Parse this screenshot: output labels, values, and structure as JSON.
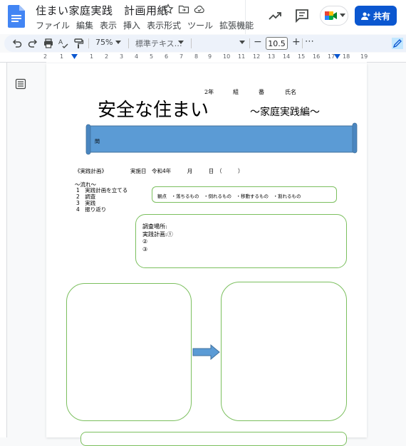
{
  "header": {
    "doc_title": "住まい家庭実践　計画用紙",
    "menu": [
      "ファイル",
      "編集",
      "表示",
      "挿入",
      "表示形式",
      "ツール",
      "拡張機能"
    ],
    "share_label": "共有"
  },
  "toolbar": {
    "zoom": "75%",
    "style": "標準テキス…",
    "font_size": "10.5",
    "minus": "−",
    "plus": "+",
    "more": "⋯"
  },
  "ruler": {
    "numbers": [
      "2",
      "1",
      "1",
      "2",
      "3",
      "4",
      "5",
      "6",
      "7",
      "8",
      "9",
      "10",
      "11",
      "12",
      "13",
      "14",
      "15",
      "16",
      "17",
      "18",
      "19"
    ]
  },
  "document": {
    "name_line": {
      "grade": "2年",
      "class": "組",
      "number": "番",
      "name": "氏名"
    },
    "title_main": "安全な住まい",
    "title_sub": "〜家庭実践編〜",
    "question_label": "問",
    "plan_heading": "《実践計画》",
    "date_label": "実施日　令和4年　　　月　　　日　（　　　）",
    "flow_title": "〜流れ〜",
    "flow_steps": [
      "1　実践計画を立てる",
      "2　調査",
      "3　実践",
      "4　振り返り"
    ],
    "viewpoint": "観点　・落ちるもの　・倒れるもの　・移動するもの　・割れるもの",
    "survey_lines": [
      "調査場所:",
      "実践計画:①",
      "②",
      "③"
    ]
  },
  "colors": {
    "share": "#0b57d0",
    "banner": "#5b9bd5",
    "box_border": "#7bbf5e",
    "arrow": "#5b9bd5"
  }
}
